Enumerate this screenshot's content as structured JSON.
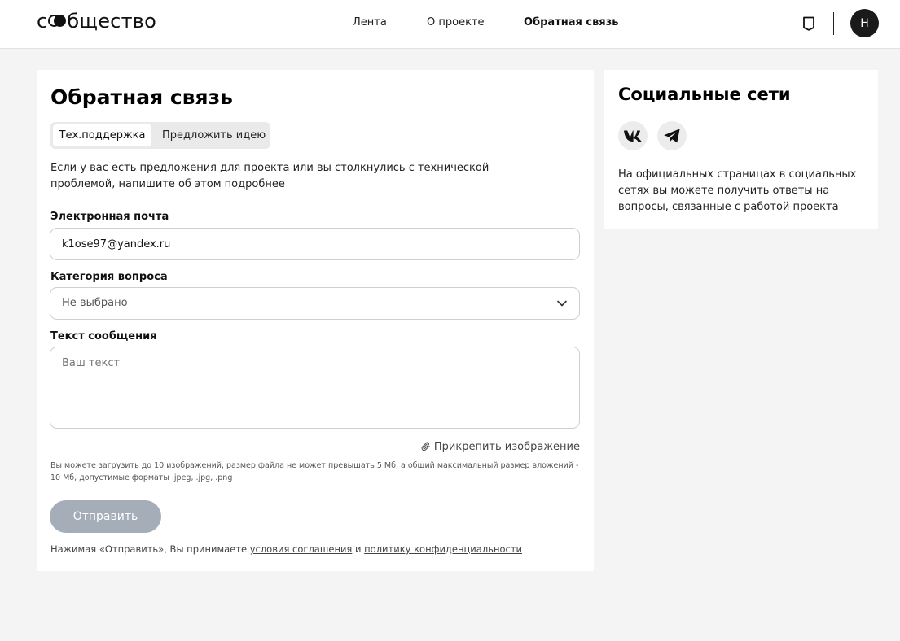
{
  "header": {
    "logo_left": "с",
    "logo_right": "бщество",
    "nav": [
      {
        "label": "Лента"
      },
      {
        "label": "О проекте"
      },
      {
        "label": "Обратная связь",
        "active": true
      }
    ],
    "avatar_initial": "Н"
  },
  "feedback": {
    "title": "Обратная связь",
    "tabs": [
      {
        "label": "Тех.поддержка",
        "active": true
      },
      {
        "label": "Предложить идею",
        "active": false
      }
    ],
    "intro": "Если у вас есть предложения для проекта или вы столкнулись с технической проблемой, напишите об этом подробнее",
    "email": {
      "label": "Электронная почта",
      "value": "k1ose97@yandex.ru"
    },
    "category": {
      "label": "Категория вопроса",
      "value": "Не выбрано"
    },
    "message": {
      "label": "Текст сообщения",
      "placeholder": "Ваш текст"
    },
    "attach_label": "Прикрепить изображение",
    "upload_hint": "Вы можете загрузить до 10 изображений, размер файла не может превышать 5 Мб, а общий максимальный размер вложений - 10 Мб, допустимые форматы .jpeg, .jpg, .png",
    "submit_label": "Отправить",
    "agreement": {
      "prefix": "Нажимая «Отправить», Вы принимаете ",
      "terms_link": "условия соглашения",
      "conjunction": " и ",
      "privacy_link": "политику конфиденциальности"
    }
  },
  "social": {
    "title": "Социальные сети",
    "icons": [
      "vk-icon",
      "telegram-icon"
    ],
    "text": "На официальных страницах в социальных сетях вы можете получить ответы на вопросы, связанные с работой проекта"
  },
  "colors": {
    "page_bg": "#f4f4f4",
    "card_bg": "#ffffff",
    "submit_disabled": "#a5adb8",
    "avatar_bg": "#1a1a1a"
  }
}
